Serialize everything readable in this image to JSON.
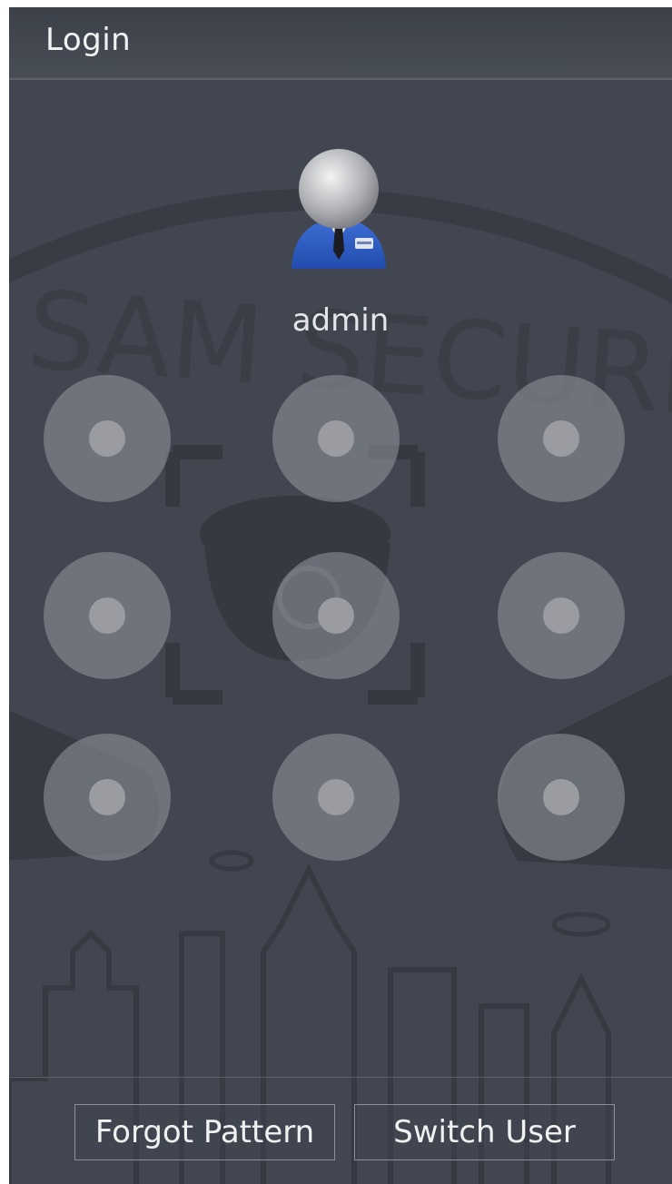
{
  "window": {
    "title": "Login"
  },
  "user": {
    "name": "admin",
    "avatar_icon": "admin-user-icon"
  },
  "pattern": {
    "grid": "3x3",
    "dots": [
      "1",
      "2",
      "3",
      "4",
      "5",
      "6",
      "7",
      "8",
      "9"
    ]
  },
  "watermark": {
    "text": "SAM SECURI"
  },
  "buttons": {
    "forgot_pattern": "Forgot Pattern",
    "switch_user": "Switch User"
  },
  "colors": {
    "background": "#414650",
    "titlebar": "#444952",
    "dot": "#9a9ca2",
    "text": "#f1f1f1"
  }
}
